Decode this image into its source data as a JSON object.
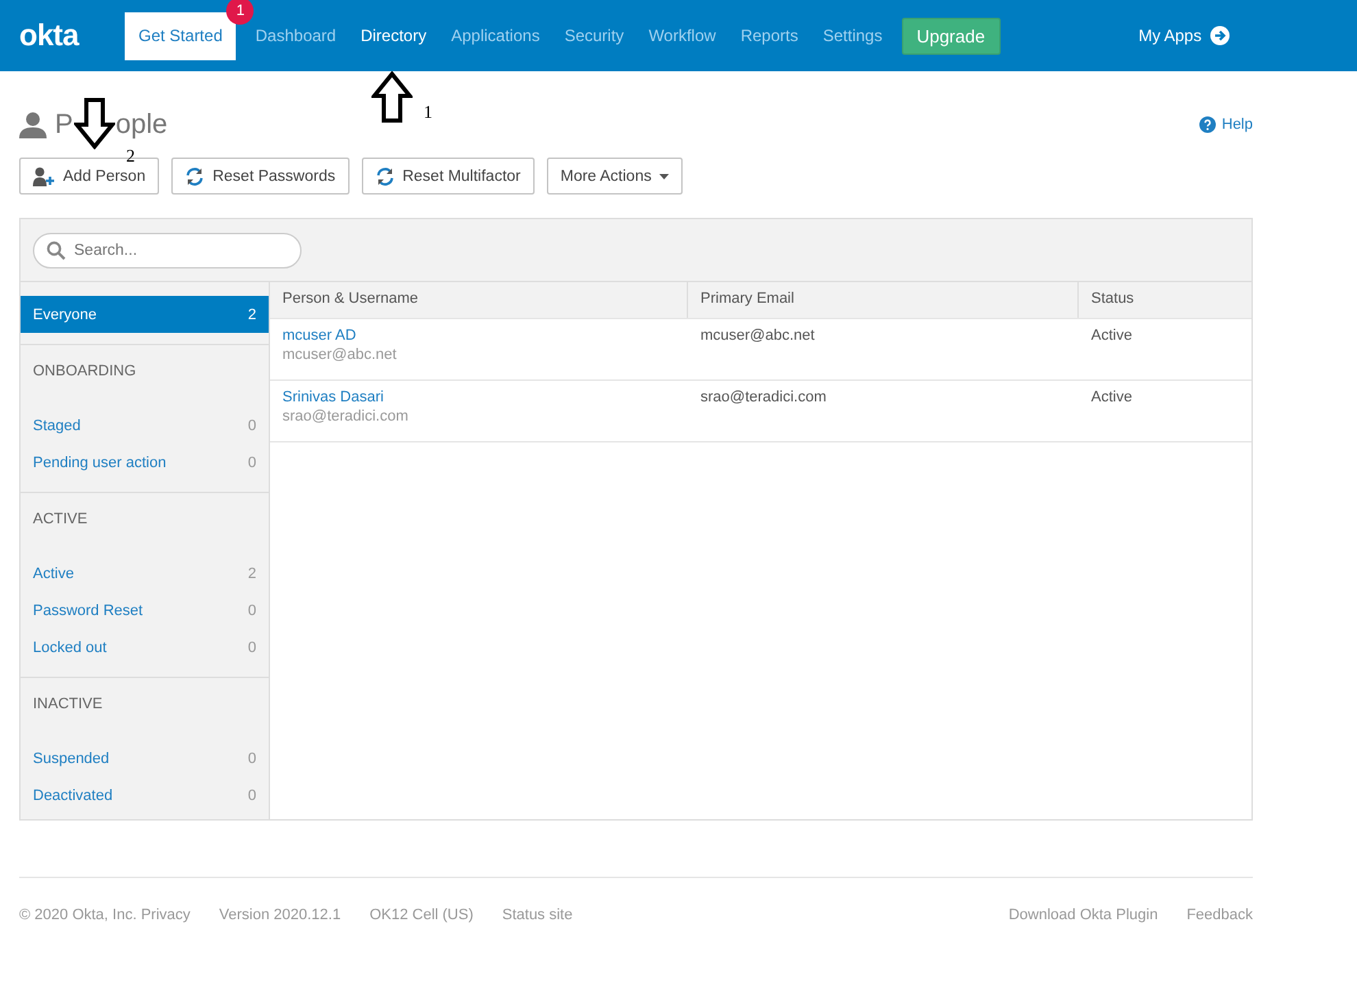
{
  "nav": {
    "logo": "okta",
    "items": [
      {
        "label": "Get Started",
        "kind": "boxed",
        "badge": "1",
        "selected": false
      },
      {
        "label": "Dashboard",
        "kind": "link",
        "selected": false
      },
      {
        "label": "Directory",
        "kind": "link",
        "selected": true
      },
      {
        "label": "Applications",
        "kind": "link",
        "selected": false
      },
      {
        "label": "Security",
        "kind": "link",
        "selected": false
      },
      {
        "label": "Workflow",
        "kind": "link",
        "selected": false
      },
      {
        "label": "Reports",
        "kind": "link",
        "selected": false
      },
      {
        "label": "Settings",
        "kind": "link",
        "selected": false
      },
      {
        "label": "Upgrade",
        "kind": "button",
        "selected": false
      }
    ],
    "my_apps": "My Apps"
  },
  "page": {
    "title_visible": [
      "P",
      "ople"
    ],
    "help": "Help"
  },
  "actions": [
    {
      "label": "Add Person",
      "kind": "add"
    },
    {
      "label": "Reset Passwords",
      "kind": "reset"
    },
    {
      "label": "Reset Multifactor",
      "kind": "reset"
    },
    {
      "label": "More Actions",
      "kind": "menu"
    }
  ],
  "search": {
    "placeholder": "Search..."
  },
  "sidebar": [
    {
      "kind": "item",
      "label": "Everyone",
      "count": "2",
      "selected": true
    },
    {
      "kind": "header",
      "label": "ONBOARDING"
    },
    {
      "kind": "item",
      "label": "Staged",
      "count": "0",
      "selected": false
    },
    {
      "kind": "item",
      "label": "Pending user action",
      "count": "0",
      "selected": false
    },
    {
      "kind": "header",
      "label": "ACTIVE"
    },
    {
      "kind": "item",
      "label": "Active",
      "count": "2",
      "selected": false
    },
    {
      "kind": "item",
      "label": "Password Reset",
      "count": "0",
      "selected": false
    },
    {
      "kind": "item",
      "label": "Locked out",
      "count": "0",
      "selected": false
    },
    {
      "kind": "header",
      "label": "INACTIVE"
    },
    {
      "kind": "item",
      "label": "Suspended",
      "count": "0",
      "selected": false
    },
    {
      "kind": "item",
      "label": "Deactivated",
      "count": "0",
      "selected": false
    }
  ],
  "table": {
    "columns": [
      "Person & Username",
      "Primary Email",
      "Status"
    ],
    "rows": [
      {
        "name": "mcuser AD",
        "username": "mcuser@abc.net",
        "email": "mcuser@abc.net",
        "status": "Active"
      },
      {
        "name": "Srinivas Dasari",
        "username": "srao@teradici.com",
        "email": "srao@teradici.com",
        "status": "Active"
      }
    ]
  },
  "footer": {
    "left": [
      "© 2020 Okta, Inc. Privacy",
      "Version 2020.12.1",
      "OK12 Cell (US)",
      "Status site"
    ],
    "right": [
      "Download Okta Plugin",
      "Feedback"
    ]
  },
  "annotations": [
    {
      "label": "1",
      "kind": "up"
    },
    {
      "label": "2",
      "kind": "down"
    }
  ]
}
